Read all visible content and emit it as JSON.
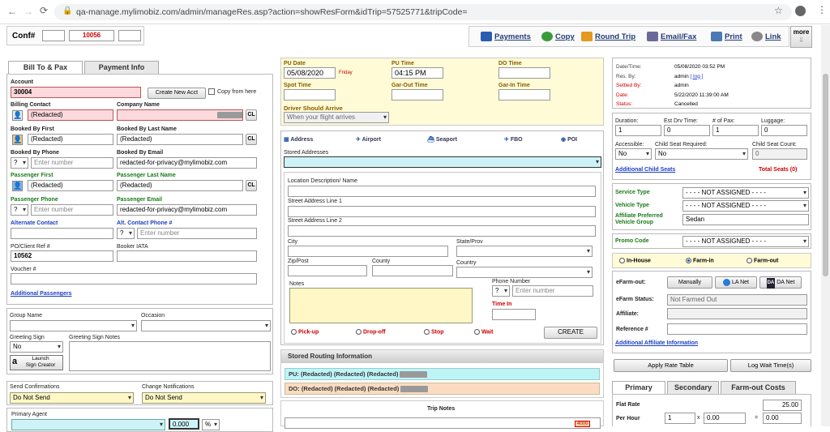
{
  "browser": {
    "url": "qa-manage.mylimobiz.com/admin/manageRes.asp?action=showResForm&idTrip=57525771&tripCode="
  },
  "header": {
    "conf_label": "Conf#",
    "conf_number": "10056",
    "more_label": "more",
    "actions": [
      "Payments",
      "Copy",
      "Round Trip",
      "Email/Fax",
      "Print",
      "Link"
    ]
  },
  "tabs": {
    "bill_to": "Bill To & Pax",
    "payment_info": "Payment Info"
  },
  "billto": {
    "account_label": "Account",
    "account_value": "30004",
    "create_acct": "Create New Acct",
    "copy_from": "Copy from here",
    "billing_contact_label": "Billing Contact",
    "billing_contact_value": "(Redacted)",
    "company_name_label": "Company Name",
    "cl": "CL",
    "booked_first_label": "Booked By First",
    "booked_first_value": "(Redacted)",
    "booked_last_label": "Booked By Last Name",
    "booked_last_value": "(Redacted)",
    "booked_phone_label": "Booked By Phone",
    "phone_code": "?",
    "phone_placeholder": "Enter number",
    "booked_email_label": "Booked By Email",
    "booked_email_value": "redacted-for-privacy@mylimobiz.com",
    "pax_first_label": "Passenger First",
    "pax_first_value": "(Redacted)",
    "pax_last_label": "Passenger Last Name",
    "pax_last_value": "(Redacted)",
    "pax_phone_label": "Passenger Phone",
    "pax_email_label": "Passenger Email",
    "pax_email_value": "redacted-for-privacy@mylimobiz.com",
    "alt_contact_label": "Alternate Contact",
    "alt_phone_label": "Alt. Contact Phone #",
    "po_label": "PO/Client Ref #",
    "po_value": "10562",
    "iata_label": "Booker IATA",
    "voucher_label": "Voucher #",
    "additional_pax": "Additional Passengers"
  },
  "misc": {
    "group_label": "Group Name",
    "occasion_label": "Occasion",
    "greeting_label": "Greeting Sign",
    "greeting_value": "No",
    "greeting_notes_label": "Greeting Sign Notes",
    "launch": "Launch",
    "sign_creator": "Sign Creator",
    "send_conf_label": "Send Confirmations",
    "send_conf_value": "Do Not Send",
    "change_notif_label": "Change Notifications",
    "change_notif_value": "Do Not Send",
    "primary_agent_label": "Primary Agent",
    "agent_pct": "0.000",
    "pct": "%"
  },
  "trip": {
    "pu_date_label": "PU Date",
    "pu_date": "05/08/2020",
    "pu_day": "Friday",
    "pu_time_label": "PU Time",
    "pu_time": "04:15 PM",
    "do_time_label": "DO Time",
    "spot_time_label": "Spot Time",
    "garout_label": "Gar-Out Time",
    "garin_label": "Gar-In Time",
    "driver_arrive_label": "Driver Should Arrive",
    "driver_arrive_value": "When your flight arrives"
  },
  "location": {
    "types": [
      "Address",
      "Airport",
      "Seaport",
      "FBO",
      "POI"
    ],
    "stored_label": "Stored Addresses",
    "desc_label": "Location Description/ Name",
    "street1_label": "Street Address Line 1",
    "street2_label": "Street Address Line 2",
    "city_label": "City",
    "state_label": "State/Prov",
    "zip_label": "Zip/Post",
    "county_label": "County",
    "country_label": "Country",
    "notes_label": "Notes",
    "phone_label": "Phone Number",
    "phone_code": "?",
    "phone_placeholder": "Enter number",
    "time_in_label": "Time In",
    "stop_types": [
      "Pick-up",
      "Drop-off",
      "Stop",
      "Wait"
    ],
    "create": "CREATE"
  },
  "routing": {
    "title": "Stored Routing Information",
    "pu": "PU: (Redacted) (Redacted) (Redacted)",
    "do": "DO: (Redacted) (Redacted) (Redacted)",
    "trip_notes": "Trip Notes",
    "badge": "4000"
  },
  "status": {
    "rows": [
      {
        "label": "Date/Time:",
        "value": "05/08/2020 03:52 PM"
      },
      {
        "label": "Res. By:",
        "value": "admin",
        "extra": "[ log ]"
      },
      {
        "label": "Settled By:",
        "value": "admin"
      },
      {
        "label": "Date:",
        "value": "5/22/2020 11:39:00 AM"
      },
      {
        "label": "Status:",
        "value": "Cancelled"
      }
    ]
  },
  "pax": {
    "duration_label": "Duration:",
    "duration": "1",
    "est_drv_label": "Est Drv Time:",
    "est_drv": "0",
    "num_pax_label": "# of Pax:",
    "num_pax": "1",
    "luggage_label": "Luggage:",
    "luggage": "0",
    "accessible_label": "Accessible:",
    "accessible": "No",
    "child_req_label": "Child Seat Required:",
    "child_req": "No",
    "child_count_label": "Child Seat Count:",
    "child_count": "0",
    "add_child": "Additional Child Seats",
    "total_seats": "Total Seats (0)"
  },
  "service": {
    "service_label": "Service Type",
    "vehicle_label": "Vehicle Type",
    "affiliate_pref_label": "Affiliate Preferred Vehicle Group",
    "not_assigned": "- - - - NOT ASSIGNED - - - -",
    "vehicle_group": "Sedan",
    "promo_label": "Promo Code"
  },
  "farm": {
    "options": [
      "In-House",
      "Farm-in",
      "Farm-out"
    ],
    "selected": "Farm-in",
    "efarm_out_label": "eFarm-out:",
    "manually": "Manually",
    "la_net": "LA Net",
    "da_net": "DA Net",
    "efarm_status_label": "eFarm Status:",
    "efarm_status": "Not Farmed Out",
    "affiliate_label": "Affiliate:",
    "reference_label": "Reference #",
    "add_aff": "Additional Affiliate Information",
    "apply_rate": "Apply Rate Table",
    "log_wait": "Log Wait Time(s)"
  },
  "rates": {
    "tabs": [
      "Primary",
      "Secondary",
      "Farm-out Costs"
    ],
    "flat_label": "Flat Rate",
    "flat": "25.00",
    "per_hour_label": "Per Hour",
    "ph_qty": "1",
    "ph_rate": "0.00",
    "ph_total": "0.00"
  }
}
